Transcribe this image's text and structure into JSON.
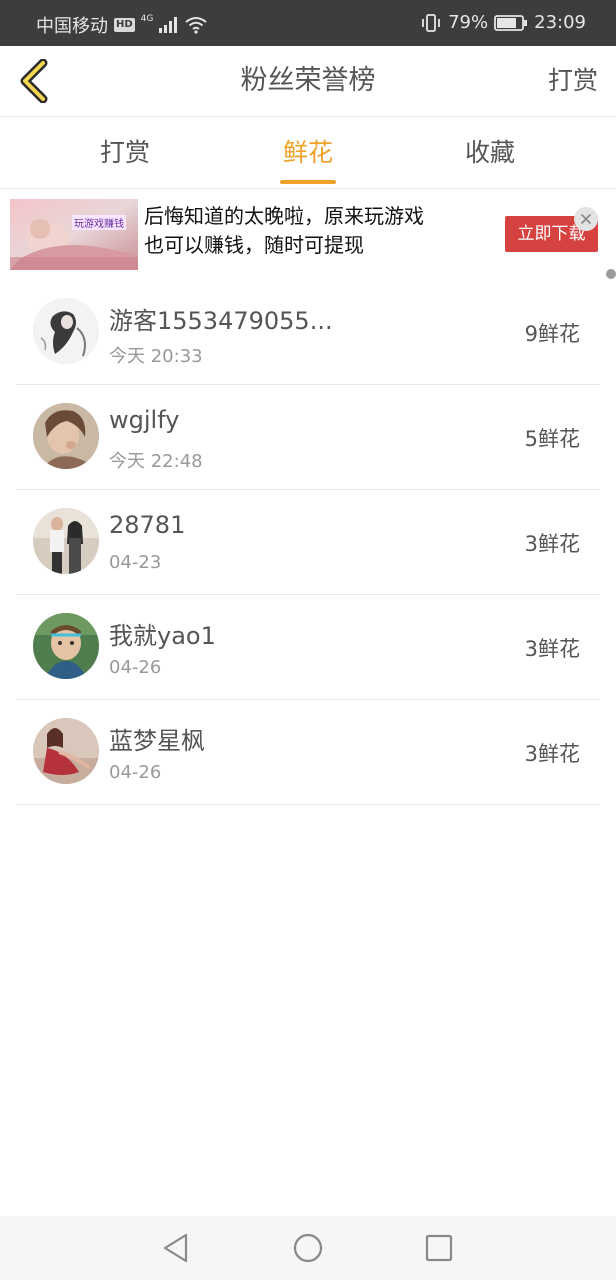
{
  "status_bar": {
    "carrier": "中国移动",
    "hd_badge": "HD",
    "network": "4G",
    "battery": "79%",
    "time": "23:09",
    "icons": [
      "signal-icon",
      "wifi-icon",
      "vibrate-icon",
      "battery-icon"
    ]
  },
  "header": {
    "title": "粉丝荣誉榜",
    "action_label": "打赏",
    "back_icon": "chevron-left-icon"
  },
  "tabs": [
    {
      "label": "打赏",
      "active": false
    },
    {
      "label": "鲜花",
      "active": true
    },
    {
      "label": "收藏",
      "active": false
    }
  ],
  "ad": {
    "thumb_label": "玩游戏赚钱",
    "line1": "后悔知道的太晚啦，原来玩游戏",
    "line2": "也可以赚钱，随时可提现",
    "button": "立即下载"
  },
  "fans": [
    {
      "name": "游客1553479055...",
      "time": "今天 20:33",
      "count": "9鲜花"
    },
    {
      "name": "wgjlfy",
      "time": "今天 22:48",
      "count": "5鲜花"
    },
    {
      "name": "28781",
      "time": "04-23",
      "count": "3鲜花"
    },
    {
      "name": "我就yao1",
      "time": "04-26",
      "count": "3鲜花"
    },
    {
      "name": "蓝梦星枫",
      "time": "04-26",
      "count": "3鲜花"
    }
  ],
  "colors": {
    "accent": "#f0a12a",
    "status_bar": "#3d3d3d",
    "ad_button": "#d6423f",
    "text": "#555555",
    "subtext": "#999999"
  }
}
